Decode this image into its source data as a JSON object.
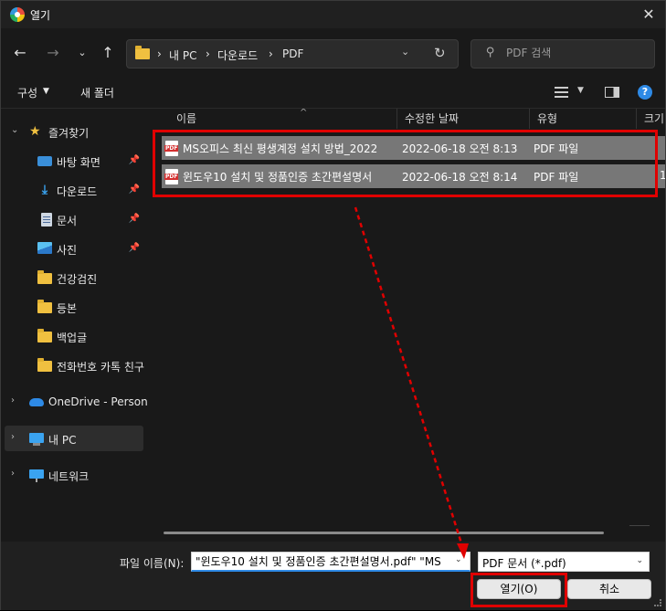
{
  "titlebar": {
    "title": "열기"
  },
  "nav": {
    "breadcrumbs": [
      "내 PC",
      "다운로드",
      "PDF"
    ],
    "search_placeholder": "PDF 검색"
  },
  "toolbar": {
    "organize": "구성",
    "new_folder": "새 폴더"
  },
  "sidebar": {
    "quick_access": "즐겨찾기",
    "items": [
      {
        "label": "바탕 화면",
        "icon": "desktop-icon",
        "pinned": true
      },
      {
        "label": "다운로드",
        "icon": "download-icon",
        "pinned": true
      },
      {
        "label": "문서",
        "icon": "document-icon",
        "pinned": true
      },
      {
        "label": "사진",
        "icon": "pictures-icon",
        "pinned": true
      },
      {
        "label": "건강검진",
        "icon": "folder-icon"
      },
      {
        "label": "등본",
        "icon": "folder-icon"
      },
      {
        "label": "백업글",
        "icon": "folder-icon"
      },
      {
        "label": "전화번호 카톡 친구",
        "icon": "folder-icon"
      }
    ],
    "onedrive": "OneDrive - Personal",
    "this_pc": "내 PC",
    "network": "네트워크"
  },
  "columns": [
    "이름",
    "수정한 날짜",
    "유형",
    "크기"
  ],
  "files": [
    {
      "name": "MS오피스 최신 평생계정 설치 방법_2022",
      "date": "2022-06-18 오전 8:13",
      "type": "PDF 파일",
      "size": ""
    },
    {
      "name": "윈도우10 설치 및 정품인증 초간편설명서",
      "date": "2022-06-18 오전 8:14",
      "type": "PDF 파일",
      "size": "1"
    }
  ],
  "bottom": {
    "filename_label": "파일 이름(N):",
    "filename_value": "\"윈도우10 설치 및 정품인증 초간편설명서.pdf\" \"MS",
    "filetype": "PDF 문서 (*.pdf)",
    "open_label": "열기(O)",
    "cancel_label": "취소"
  },
  "colors": {
    "annotation": "#e00000",
    "selection": "#777777",
    "accent": "#2e8ae6"
  }
}
